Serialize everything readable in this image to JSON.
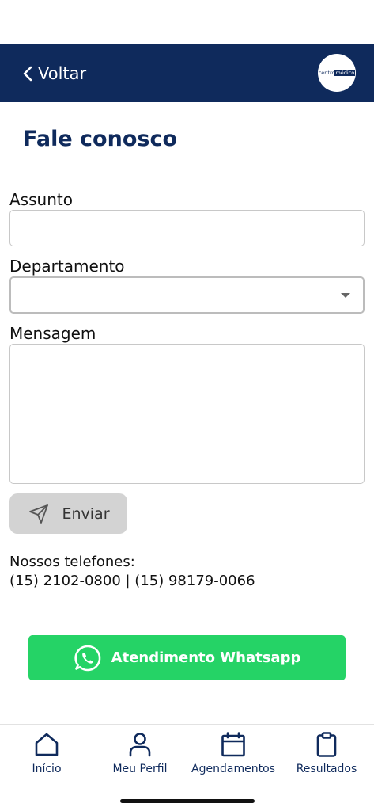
{
  "header": {
    "back_label": "Voltar",
    "logo": {
      "text_left": "centro",
      "text_highlight": "médico",
      "text_right": ""
    }
  },
  "page": {
    "title": "Fale conosco"
  },
  "form": {
    "subject_label": "Assunto",
    "subject_value": "",
    "department_label": "Departamento",
    "department_value": "",
    "message_label": "Mensagem",
    "message_value": "",
    "send_label": "Enviar"
  },
  "contact": {
    "phones_label": "Nossos telefones:",
    "phones_value": "(15) 2102-0800 | (15) 98179-0066",
    "whatsapp_label": "Atendimento Whatsapp"
  },
  "tabbar": {
    "items": [
      {
        "label": "Início",
        "icon": "home-icon"
      },
      {
        "label": "Meu Perfil",
        "icon": "user-icon"
      },
      {
        "label": "Agendamentos",
        "icon": "calendar-icon"
      },
      {
        "label": "Resultados",
        "icon": "clipboard-icon"
      }
    ]
  },
  "colors": {
    "header_bg": "#0f2a5c",
    "whatsapp_green": "#25d366",
    "send_button_disabled": "#d3d3d3"
  }
}
